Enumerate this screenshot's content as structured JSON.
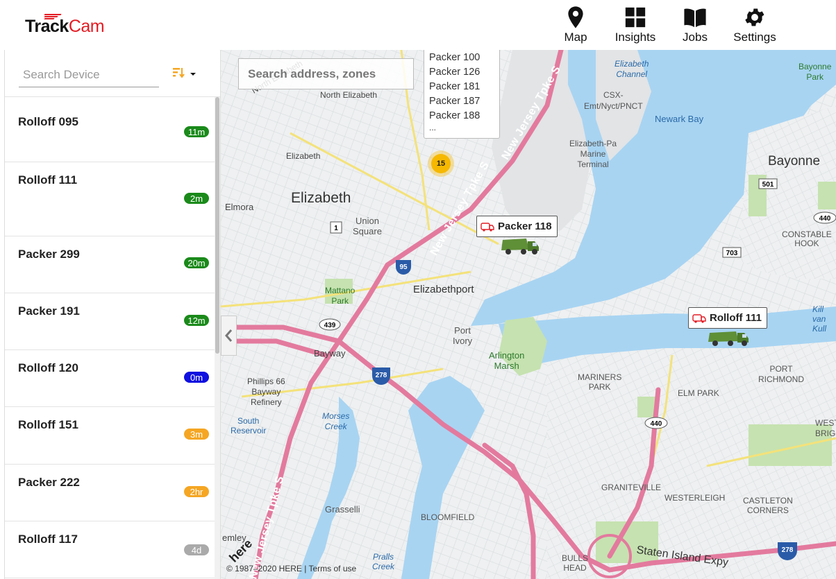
{
  "app": {
    "logo_track": "Track",
    "logo_cam": "Cam",
    "accent_color": "#e31b23"
  },
  "nav": [
    {
      "label": "Map",
      "icon": "map-pin-icon"
    },
    {
      "label": "Insights",
      "icon": "dashboard-grid-icon"
    },
    {
      "label": "Jobs",
      "icon": "book-icon"
    },
    {
      "label": "Settings",
      "icon": "gear-icon"
    }
  ],
  "sidebar": {
    "search_placeholder": "Search Device",
    "sort_icon": "sort-icon",
    "devices": [
      {
        "name": "Rolloff 095",
        "badge": "11m",
        "badge_color": "#1a8a1a"
      },
      {
        "name": "Rolloff 111",
        "badge": "2m",
        "badge_color": "#1a8a1a"
      },
      {
        "name": "Packer 299",
        "badge": "20m",
        "badge_color": "#1a8a1a"
      },
      {
        "name": "Packer 191",
        "badge": "12m",
        "badge_color": "#1a8a1a"
      },
      {
        "name": "Rolloff 120",
        "badge": "0m",
        "badge_color": "#1010e0"
      },
      {
        "name": "Rolloff 151",
        "badge": "3m",
        "badge_color": "#f5a623"
      },
      {
        "name": "Packer 222",
        "badge": "2hr",
        "badge_color": "#f5a623"
      },
      {
        "name": "Rolloff 117",
        "badge": "4d",
        "badge_color": "#aaaaaa"
      }
    ]
  },
  "map": {
    "search_placeholder": "Search address, zones",
    "cluster_count": "15",
    "cluster_popup_items": [
      "Packer 100",
      "Packer 126",
      "Packer 181",
      "Packer 187",
      "Packer 188",
      "..."
    ],
    "vehicles": [
      {
        "name": "Packer 118"
      },
      {
        "name": "Rolloff 111"
      }
    ],
    "labels": {
      "north_elizabeth": "North Elizabeth",
      "elizabeth_station": "Elizabeth",
      "elizabeth": "Elizabeth",
      "elmora": "Elmora",
      "union_square": "Union\nSquare",
      "elizabethport": "Elizabethport",
      "mattano_park": "Mattano\nPark",
      "port_ivory": "Port\nIvory",
      "arlington_marsh": "Arlington\nMarsh",
      "bayway": "Bayway",
      "phillips66": "Phillips 66\nBayway\nRefinery",
      "south_reservoir": "South\nReservoir",
      "morses_creek": "Morses\nCreek",
      "grasselli": "Grasselli",
      "bloomfield": "BLOOMFIELD",
      "mariners_park": "MARINERS\nPARK",
      "elm_park": "ELM PARK",
      "port_richmond": "PORT\nRICHMOND",
      "graniteville": "GRANITEVILLE",
      "westerleigh": "WESTERLEIGH",
      "castleton_corners": "CASTLETON\nCORNERS",
      "bulls_head": "BULLS\nHEAD",
      "staten_island_expy": "Staten Island Expy",
      "elizabeth_channel": "Elizabeth\nChannel",
      "csx": "CSX-\nEmt/Nyct/PNCT",
      "newark_bay": "Newark Bay",
      "elizabeth_pa_marine": "Elizabeth-Pa\nMarine\nTerminal",
      "bayonne": "Bayonne",
      "bayonne_park": "Bayonne\nPark",
      "constable_hook": "CONSTABLE\nHOOK",
      "kill_van_kull": "Kill\nvan\nKull",
      "west_brighton": "WEST\nBRIGH",
      "pralls_creek": "Pralls\nCreek",
      "nj_tpke_1": "New Jersey Tpke S",
      "nj_tpke_2": "New Jersey Tpke S",
      "nj_tpke_3": "New Jersey Tpke S",
      "here_logo": "here",
      "emley": "emley"
    },
    "shields": [
      "1",
      "95",
      "439",
      "278",
      "501",
      "703",
      "440",
      "278",
      "440"
    ],
    "copyright": "© 1987–2020 HERE | ",
    "terms": "Terms of use",
    "colors": {
      "water": "#a8d4f2",
      "highway": "#e37a9e",
      "park": "#c6e2b0"
    }
  }
}
